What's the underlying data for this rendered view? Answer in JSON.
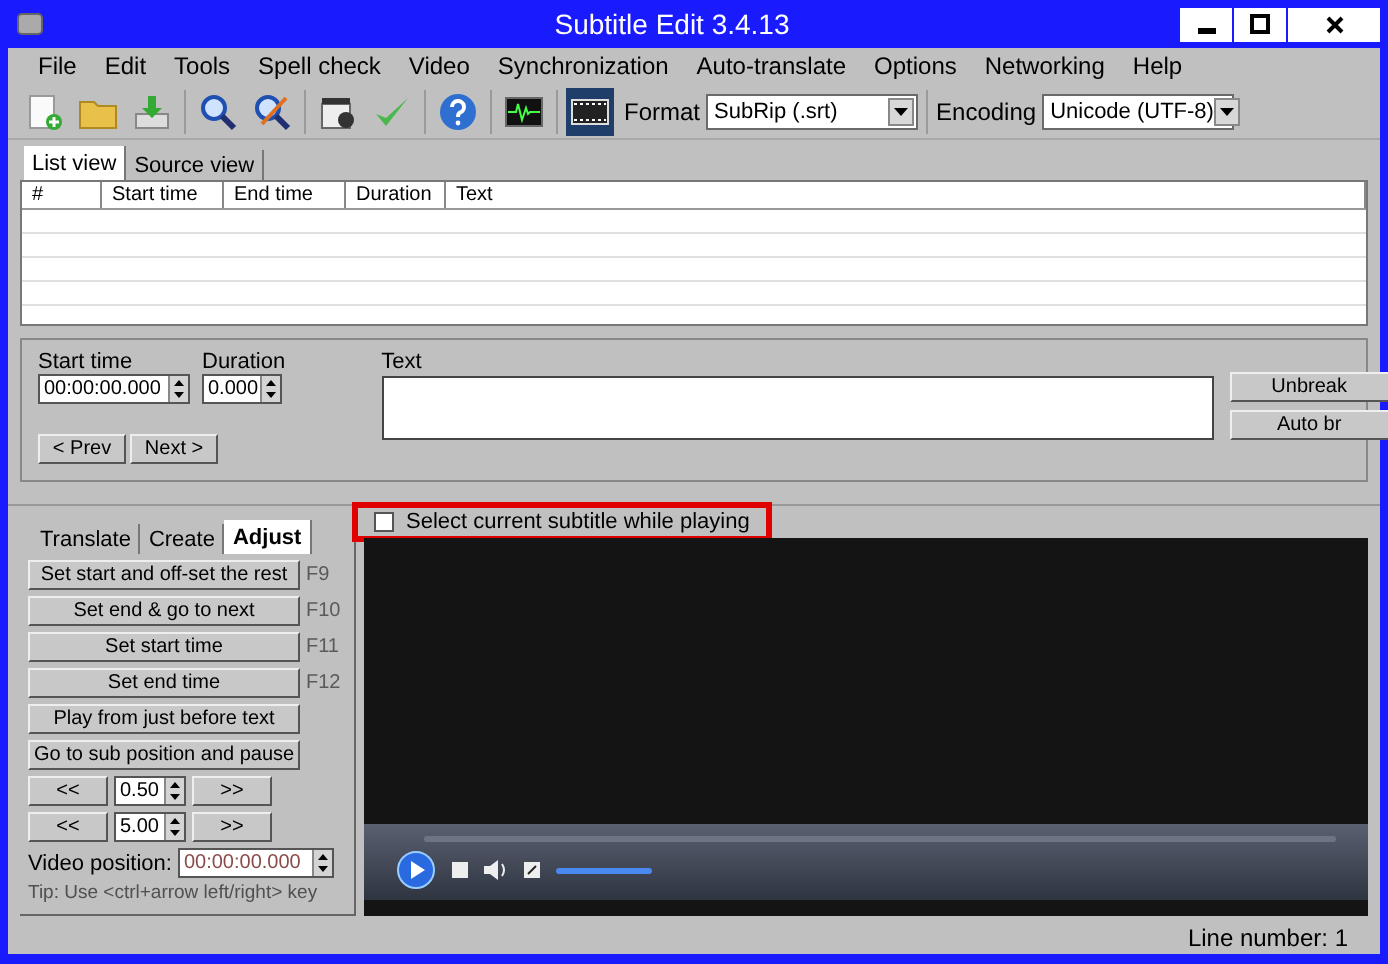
{
  "window": {
    "title": "Subtitle Edit 3.4.13"
  },
  "menu": [
    "File",
    "Edit",
    "Tools",
    "Spell check",
    "Video",
    "Synchronization",
    "Auto-translate",
    "Options",
    "Networking",
    "Help"
  ],
  "toolbar": {
    "tools": [
      {
        "kind": "new",
        "selected": false
      },
      {
        "kind": "open",
        "selected": false
      },
      {
        "kind": "save",
        "selected": false
      },
      {
        "kind": "find",
        "selected": false
      },
      {
        "kind": "replace",
        "selected": false
      },
      {
        "kind": "videofile",
        "selected": false
      },
      {
        "kind": "check",
        "selected": false
      },
      {
        "kind": "help",
        "selected": false
      },
      {
        "kind": "waveform",
        "selected": false
      },
      {
        "kind": "filmstrip",
        "selected": true
      }
    ],
    "format": {
      "label": "Format",
      "value": "SubRip (.srt)"
    },
    "encoding": {
      "label": "Encoding",
      "value": "Unicode (UTF-8)"
    }
  },
  "view_tabs": [
    {
      "label": "List view",
      "selected": true
    },
    {
      "label": "Source view",
      "selected": false
    }
  ],
  "table": {
    "columns": [
      "#",
      "Start time",
      "End time",
      "Duration",
      "Text"
    ]
  },
  "editor": {
    "start_time": {
      "label": "Start time",
      "value": "00:00:00.000"
    },
    "duration": {
      "label": "Duration",
      "value": "0.000"
    },
    "text": {
      "label": "Text"
    },
    "buttons": [
      "Unbreak",
      "Auto br"
    ],
    "nav": [
      "< Prev",
      "Next >"
    ]
  },
  "tool_tabs": [
    {
      "label": "Translate",
      "selected": false
    },
    {
      "label": "Create",
      "selected": false
    },
    {
      "label": "Adjust",
      "selected": true
    }
  ],
  "adjust": {
    "actions": [
      {
        "label": "Set start and off-set the rest",
        "shortcut": "F9"
      },
      {
        "label": "Set end & go to next",
        "shortcut": "F10"
      },
      {
        "label": "Set start time",
        "shortcut": "F11"
      },
      {
        "label": "Set end time",
        "shortcut": "F12"
      },
      {
        "label": "Play from just before text"
      },
      {
        "label": "Go to sub position and pause"
      }
    ],
    "steps": [
      {
        "back": "<<",
        "value": "0.50",
        "forward": ">>"
      },
      {
        "back": "<<",
        "value": "5.00",
        "forward": ">>"
      }
    ],
    "video_position": {
      "label": "Video position:",
      "value": "00:00:00.000",
      "disabled": true
    },
    "tip": "Tip: Use <ctrl+arrow left/right> key"
  },
  "select_current": {
    "label": "Select current subtitle while playing",
    "checked": false,
    "highlighted": true
  },
  "player": {
    "volume": {
      "level": 1
    }
  },
  "status_bar": {
    "line_number": "Line number: 1"
  }
}
